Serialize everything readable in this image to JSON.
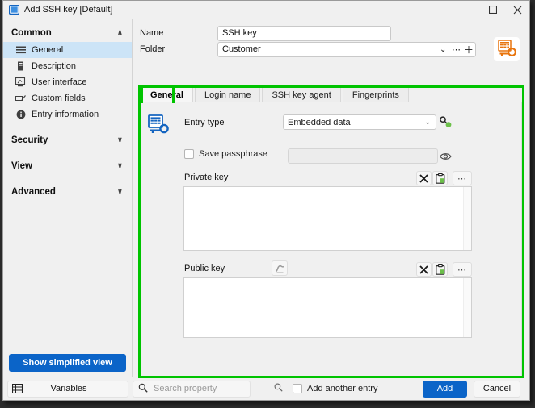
{
  "window": {
    "title": "Add SSH key [Default]",
    "title_icon": "window-icon",
    "maximize_glyph": "☐",
    "close_glyph": "✕"
  },
  "sidebar": {
    "groups": [
      {
        "label": "Common",
        "expanded_glyph": "∧",
        "items": [
          {
            "label": "General",
            "icon": "list-icon",
            "selected": true
          },
          {
            "label": "Description",
            "icon": "note-icon",
            "selected": false
          },
          {
            "label": "User interface",
            "icon": "monitor-icon",
            "selected": false
          },
          {
            "label": "Custom fields",
            "icon": "custom-field-icon",
            "selected": false
          },
          {
            "label": "Entry information",
            "icon": "info-icon",
            "selected": false
          }
        ]
      },
      {
        "label": "Security",
        "expanded_glyph": "∨",
        "items": []
      },
      {
        "label": "View",
        "expanded_glyph": "∨",
        "items": []
      },
      {
        "label": "Advanced",
        "expanded_glyph": "∨",
        "items": []
      }
    ],
    "simplified_button": "Show simplified view"
  },
  "header": {
    "name_label": "Name",
    "name_value": "SSH key",
    "folder_label": "Folder",
    "folder_value": "Customer",
    "folder_dropdown_glyph": "⌄",
    "folder_more_glyph": "⋯",
    "folder_add_glyph": "＋",
    "entry_type_icon": "ssh-key-orange-icon"
  },
  "tabs": [
    {
      "label": "General",
      "active": true
    },
    {
      "label": "Login name",
      "active": false
    },
    {
      "label": "SSH key agent",
      "active": false
    },
    {
      "label": "Fingerprints",
      "active": false
    }
  ],
  "general_tab": {
    "section_icon": "ssh-key-blue-icon",
    "entry_type_label": "Entry type",
    "entry_type_value": "Embedded data",
    "entry_type_dropdown_glyph": "⌄",
    "entry_type_action_icon": "key-generate-icon",
    "save_passphrase_label": "Save passphrase",
    "save_passphrase_checked": false,
    "passphrase_value": "",
    "passphrase_reveal_icon": "eye-icon",
    "private_key": {
      "label": "Private key",
      "value": "",
      "clear_icon": "x-icon",
      "paste_icon": "clipboard-icon",
      "more_label": "⋯"
    },
    "public_key": {
      "label": "Public key",
      "value": "",
      "signature_icon": "signature-icon",
      "clear_icon": "x-icon",
      "paste_icon": "clipboard-icon",
      "more_label": "⋯"
    }
  },
  "statusbar": {
    "variables_label": "Variables",
    "variables_icon": "grid-icon",
    "search_placeholder": "Search property",
    "search_value": "",
    "search_icon": "search-icon",
    "search_icon_right": "magnifier-icon",
    "add_another_label": "Add another entry",
    "add_another_checked": false,
    "add_button": "Add",
    "cancel_button": "Cancel"
  },
  "colors": {
    "accent": "#0b64c8",
    "selection": "#cce4f7",
    "annotation": "#00c400",
    "window_bg": "#f0f0f0",
    "orange_icon": "#e8740c"
  }
}
